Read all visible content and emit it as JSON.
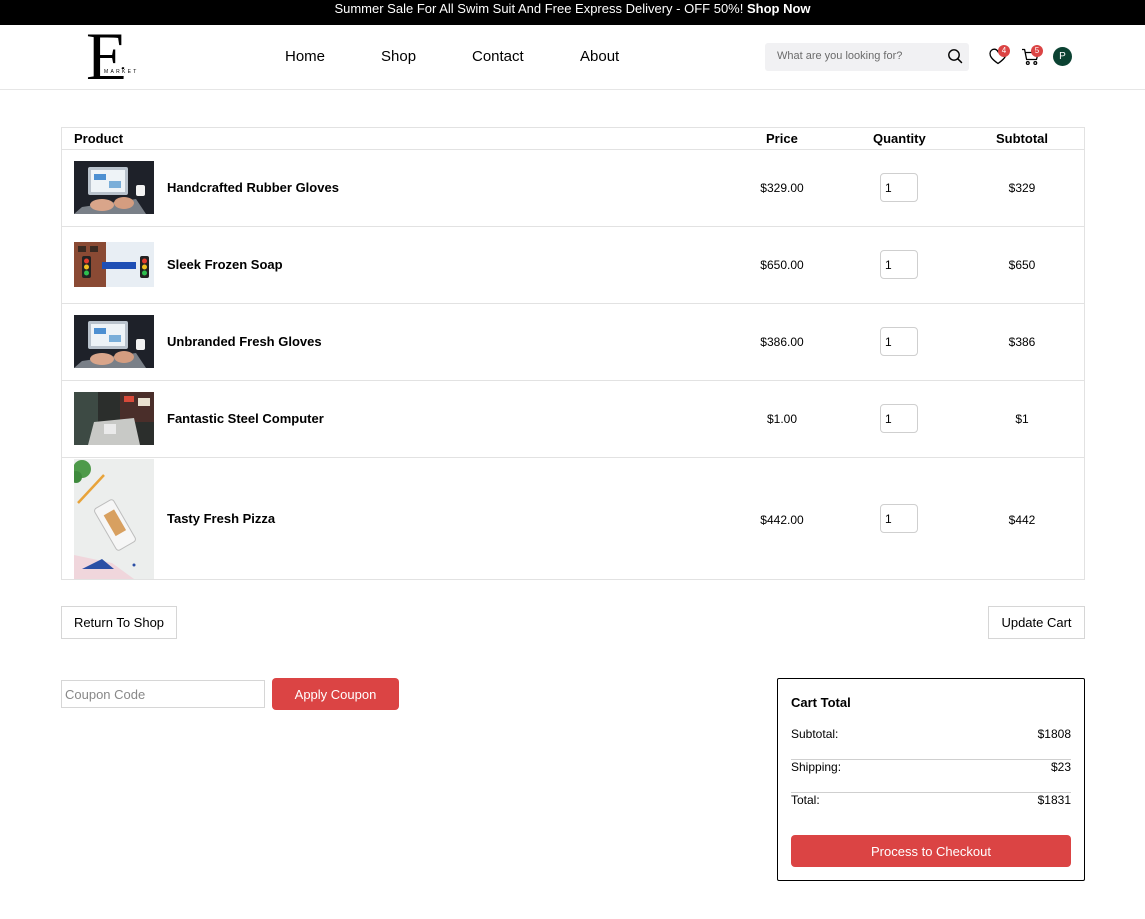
{
  "promo": {
    "text": "Summer Sale For All Swim Suit And Free Express Delivery - OFF 50%!",
    "link": "Shop Now"
  },
  "header": {
    "logo_letter": "E",
    "logo_word": "MARKET",
    "nav": [
      "Home",
      "Shop",
      "Contact",
      "About"
    ],
    "search_placeholder": "What are you looking for?",
    "wishlist_count": "4",
    "cart_count": "5",
    "avatar_initial": "P"
  },
  "cart": {
    "headers": {
      "product": "Product",
      "price": "Price",
      "quantity": "Quantity",
      "subtotal": "Subtotal"
    },
    "items": [
      {
        "name": "Handcrafted Rubber Gloves",
        "price": "$329.00",
        "qty": "1",
        "subtotal": "$329",
        "image": "laptop-photo"
      },
      {
        "name": "Sleek Frozen Soap",
        "price": "$650.00",
        "qty": "1",
        "subtotal": "$650",
        "image": "street-sign-photo"
      },
      {
        "name": "Unbranded Fresh Gloves",
        "price": "$386.00",
        "qty": "1",
        "subtotal": "$386",
        "image": "laptop-photo"
      },
      {
        "name": "Fantastic Steel Computer",
        "price": "$1.00",
        "qty": "1",
        "subtotal": "$1",
        "image": "cafe-photo"
      },
      {
        "name": "Tasty Fresh Pizza",
        "price": "$442.00",
        "qty": "1",
        "subtotal": "$442",
        "image": "phone-desk-photo"
      }
    ]
  },
  "actions": {
    "return_label": "Return To Shop",
    "update_label": "Update Cart",
    "coupon_placeholder": "Coupon Code",
    "apply_label": "Apply Coupon"
  },
  "total": {
    "title": "Cart Total",
    "subtotal_label": "Subtotal:",
    "subtotal_value": "$1808",
    "shipping_label": "Shipping:",
    "shipping_value": "$23",
    "total_label": "Total:",
    "total_value": "$1831",
    "checkout_label": "Process to Checkout"
  },
  "colors": {
    "accent": "#db4444",
    "avatar": "#0b4232",
    "promo_bg": "#000000"
  }
}
